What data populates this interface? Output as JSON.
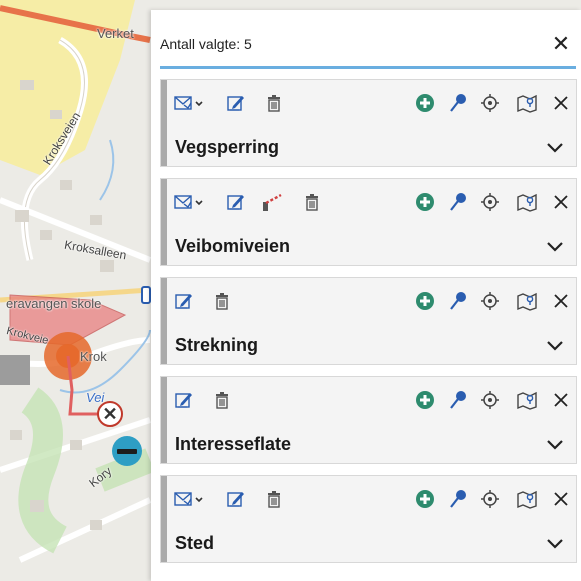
{
  "map": {
    "labels": {
      "verket": "Verket",
      "kroksveien": "Kroksveien",
      "kroksalleen": "Kroksalleen",
      "skole": "eravangen skole",
      "krok": "Krok",
      "krokvei": "Krokveie",
      "kory": "Kory",
      "vei": "Vei"
    },
    "icons": {
      "close": "close-circle-icon",
      "minus": "minus-circle-icon"
    }
  },
  "panel": {
    "title": "Antall valgte: 5",
    "close_glyph": "✕",
    "cards": [
      {
        "title": "Vegsperring",
        "tools_left": [
          "mail-dropdown-icon",
          "edit-icon",
          "delete-icon"
        ],
        "tools_right": [
          "add-icon",
          "pin-icon",
          "target-icon",
          "map-icon",
          "close-icon"
        ]
      },
      {
        "title": "Veibomiveien",
        "tools_left": [
          "mail-dropdown-icon",
          "edit-icon",
          "barrier-icon",
          "delete-icon"
        ],
        "tools_right": [
          "add-icon",
          "pin-icon",
          "target-icon",
          "map-icon",
          "close-icon"
        ]
      },
      {
        "title": "Strekning",
        "tools_left": [
          "edit-icon",
          "delete-icon"
        ],
        "tools_right": [
          "add-icon",
          "pin-icon",
          "target-icon",
          "map-icon",
          "close-icon"
        ]
      },
      {
        "title": "Interesseflate",
        "tools_left": [
          "edit-icon",
          "delete-icon"
        ],
        "tools_right": [
          "add-icon",
          "pin-icon",
          "target-icon",
          "map-icon",
          "close-icon"
        ]
      },
      {
        "title": "Sted",
        "tools_left": [
          "mail-dropdown-icon",
          "edit-icon",
          "delete-icon"
        ],
        "tools_right": [
          "add-icon",
          "pin-icon",
          "target-icon",
          "map-icon",
          "close-icon"
        ]
      }
    ]
  },
  "colors": {
    "accent_rule": "#6aaee0",
    "add_icon": "#2e8b6e",
    "pin_icon": "#2a5db0",
    "map_marker": "#e5682a",
    "map_area": "#e88080"
  }
}
